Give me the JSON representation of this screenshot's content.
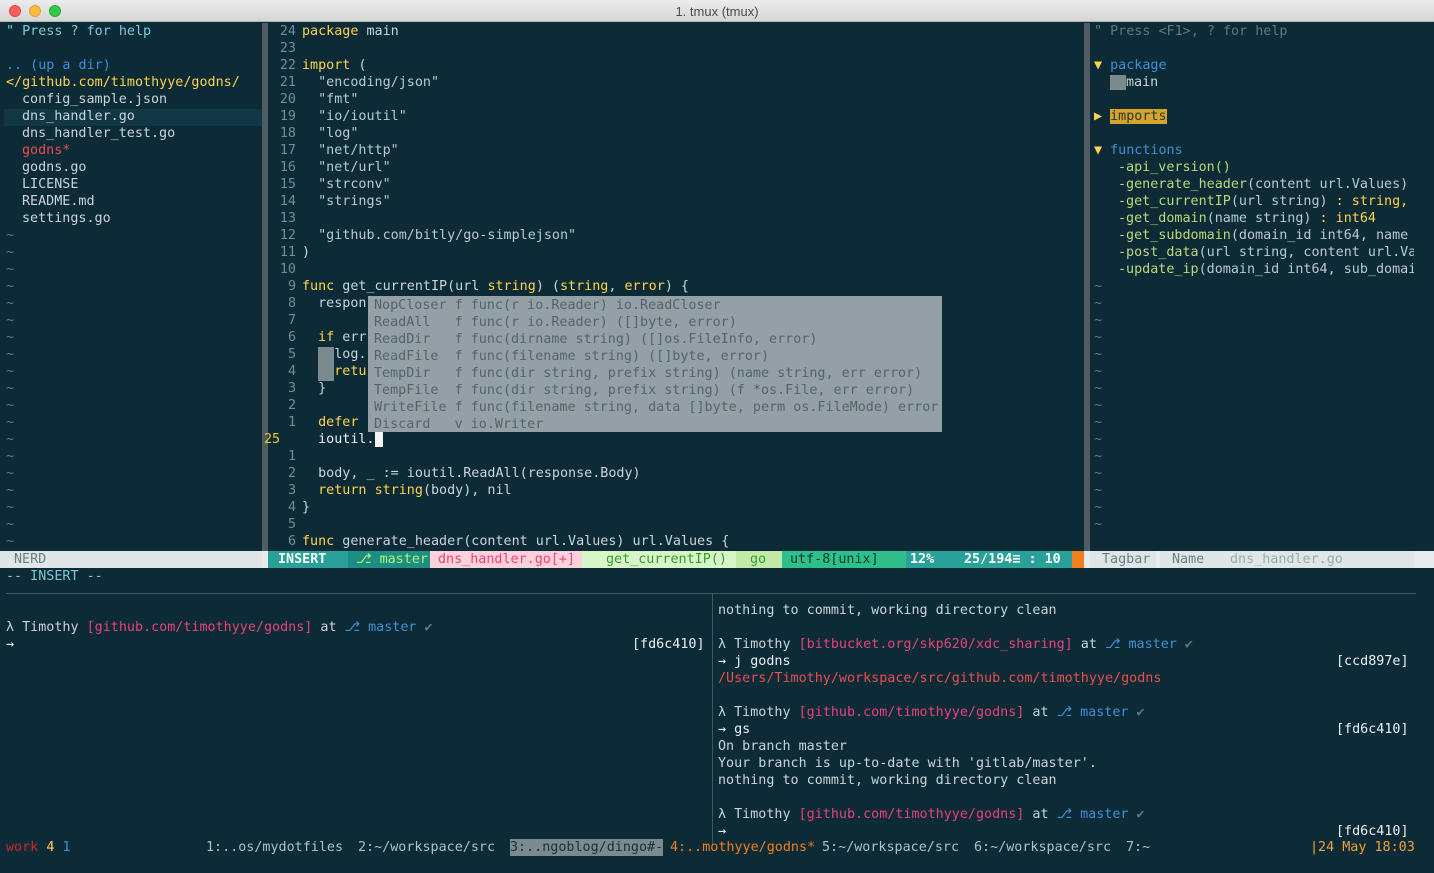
{
  "window": {
    "title": "1. tmux (tmux)"
  },
  "nerdtree": {
    "help": "\" Press ? for help",
    "up": ".. (up a dir)",
    "root": "</github.com/timothyye/godns/",
    "files": [
      {
        "name": "config_sample.json",
        "style": "normal"
      },
      {
        "name": "dns_handler.go",
        "style": "normal"
      },
      {
        "name": "dns_handler_test.go",
        "style": "normal"
      },
      {
        "name": "godns*",
        "style": "exec"
      },
      {
        "name": "godns.go",
        "style": "normal"
      },
      {
        "name": "LICENSE",
        "style": "normal"
      },
      {
        "name": "README.md",
        "style": "normal"
      },
      {
        "name": "settings.go",
        "style": "normal"
      }
    ],
    "tilde": "~"
  },
  "editor": {
    "lines": [
      {
        "num": "24",
        "text": "package main",
        "kind": "pkg"
      },
      {
        "num": "23",
        "text": "",
        "kind": "blank"
      },
      {
        "num": "22",
        "text": "import (",
        "kind": "import"
      },
      {
        "num": "21",
        "text": "  \"encoding/json\"",
        "kind": "string"
      },
      {
        "num": "20",
        "text": "  \"fmt\"",
        "kind": "string"
      },
      {
        "num": "19",
        "text": "  \"io/ioutil\"",
        "kind": "string"
      },
      {
        "num": "18",
        "text": "  \"log\"",
        "kind": "string"
      },
      {
        "num": "17",
        "text": "  \"net/http\"",
        "kind": "string"
      },
      {
        "num": "16",
        "text": "  \"net/url\"",
        "kind": "string"
      },
      {
        "num": "15",
        "text": "  \"strconv\"",
        "kind": "string"
      },
      {
        "num": "14",
        "text": "  \"strings\"",
        "kind": "string"
      },
      {
        "num": "13",
        "text": "",
        "kind": "blank"
      },
      {
        "num": "12",
        "text": "  \"github.com/bitly/go-simplejson\"",
        "kind": "string"
      },
      {
        "num": "11",
        "text": ")",
        "kind": "plain"
      },
      {
        "num": "10",
        "text": "",
        "kind": "blank"
      },
      {
        "num": "9",
        "text": "func get_currentIP(url string) (string, error) {",
        "kind": "func"
      },
      {
        "num": "8",
        "text": "  respon",
        "kind": "plain"
      },
      {
        "num": "7",
        "text": "",
        "kind": "blank"
      },
      {
        "num": "6",
        "text": "  if err",
        "kind": "if"
      },
      {
        "num": "5",
        "text": "    log.",
        "kind": "plain"
      },
      {
        "num": "4",
        "text": "    retu",
        "kind": "return"
      },
      {
        "num": "3",
        "text": "  }",
        "kind": "plain"
      },
      {
        "num": "2",
        "text": "",
        "kind": "blank"
      },
      {
        "num": "1",
        "text": "  defer",
        "kind": "defer"
      },
      {
        "num": "25",
        "text": "  ioutil.",
        "kind": "current"
      },
      {
        "num": "1",
        "text": "",
        "kind": "blank"
      },
      {
        "num": "2",
        "text": "  body, _ := ioutil.ReadAll(response.Body)",
        "kind": "plain"
      },
      {
        "num": "3",
        "text": "  return string(body), nil",
        "kind": "return2"
      },
      {
        "num": "4",
        "text": "}",
        "kind": "plain"
      },
      {
        "num": "5",
        "text": "",
        "kind": "blank"
      },
      {
        "num": "6",
        "text": "func generate_header(content url.Values) url.Values {",
        "kind": "func2"
      }
    ],
    "completion": [
      "NopCloser f func(r io.Reader) io.ReadCloser",
      "ReadAll   f func(r io.Reader) ([]byte, error)",
      "ReadDir   f func(dirname string) ([]os.FileInfo, error)",
      "ReadFile  f func(filename string) ([]byte, error)",
      "TempDir   f func(dir string, prefix string) (name string, err error)",
      "TempFile  f func(dir string, prefix string) (f *os.File, err error)",
      "WriteFile f func(filename string, data []byte, perm os.FileMode) error",
      "Discard   v io.Writer"
    ]
  },
  "tagbar": {
    "help": "\" Press <F1>, ? for help",
    "package_header": "package",
    "package_item": "main",
    "imports_header": "imports",
    "functions_header": "functions",
    "functions": [
      {
        "name": "-api_version()",
        "sig": "",
        "ret": ""
      },
      {
        "name": "-generate_header",
        "sig": "(content url.Values)",
        "ret": ""
      },
      {
        "name": "-get_currentIP",
        "sig": "(url string)",
        "ret": " : string,"
      },
      {
        "name": "-get_domain",
        "sig": "(name string)",
        "ret": " : int64"
      },
      {
        "name": "-get_subdomain",
        "sig": "(domain_id int64, name",
        "ret": ""
      },
      {
        "name": "-post_data",
        "sig": "(url string, content url.Va",
        "ret": ""
      },
      {
        "name": "-update_ip",
        "sig": "(domain_id int64, sub_domai",
        "ret": ""
      }
    ]
  },
  "statusline": {
    "nerd": "NERD",
    "mode": "INSERT",
    "branch": "master",
    "file": "dns_handler.go[+]",
    "func": "get_currentIP()",
    "filetype": "go",
    "encoding": "utf-8[unix]",
    "percent": "12%",
    "position": "25/194≡ : 10",
    "tagbar_label": "Tagbar",
    "tagbar_sort": "Name",
    "tagbar_file": "dns_handler.go"
  },
  "cmdline": "-- INSERT --",
  "shell_left": {
    "user": "λ Timothy",
    "path": "[github.com/timothyye/godns]",
    "at": "at",
    "branch": "master",
    "check": "✔",
    "prompt": "→",
    "hash": "[fd6c410]"
  },
  "shell_right": {
    "top": "nothing to commit, working directory clean",
    "user": "λ Timothy",
    "path1": "[bitbucket.org/skp620/xdc_sharing]",
    "path2": "[github.com/timothyye/godns]",
    "at": "at",
    "branch": "master",
    "check": "✔",
    "cmd1": "→ j godns",
    "hash1": "[ccd897e]",
    "jump_path": "/Users/Timothy/workspace/src/github.com/timothyye/godns",
    "cmd2": "→ gs",
    "hash2": "[fd6c410]",
    "git1": "On branch master",
    "git2": "Your branch is up-to-date with 'gitlab/master'.",
    "git3": "nothing to commit, working directory clean",
    "prompt": "→",
    "hash3": "[fd6c410]"
  },
  "tmux": {
    "session": "work",
    "window_num": "4",
    "pane_num": "1",
    "windows": [
      "1:..os/mydotfiles",
      "2:~/workspace/src",
      "3:..ngoblog/dingo#-",
      "4:..mothyye/godns*",
      "5:~/workspace/src",
      "6:~/workspace/src",
      "7:~"
    ],
    "clock": "|24 May 18:03"
  }
}
